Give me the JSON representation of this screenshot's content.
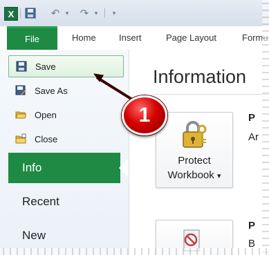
{
  "qat": {
    "app_icon_letter": "X",
    "save_icon": "save-icon",
    "undo_icon": "undo-icon",
    "redo_icon": "redo-icon",
    "customize_icon": "customize-qat-icon"
  },
  "ribbon_tabs": [
    "File",
    "Home",
    "Insert",
    "Page Layout",
    "Formu"
  ],
  "backstage_commands": [
    {
      "label": "Save",
      "icon": "floppy-disk-icon"
    },
    {
      "label": "Save As",
      "icon": "save-as-icon"
    },
    {
      "label": "Open",
      "icon": "folder-open-icon"
    },
    {
      "label": "Close",
      "icon": "folder-close-icon"
    }
  ],
  "backstage_nav": [
    "Info",
    "Recent",
    "New"
  ],
  "main": {
    "title": "Information",
    "protect_button": {
      "line1": "Protect",
      "line2": "Workbook",
      "dropdown": "▾"
    },
    "right_fragments": [
      "P",
      "Ar",
      "P",
      "B"
    ]
  },
  "callout": {
    "number": "1"
  },
  "colors": {
    "file_tab": "#1f8a44",
    "nav_selected": "#1f8a44",
    "badge": "#d40000"
  }
}
